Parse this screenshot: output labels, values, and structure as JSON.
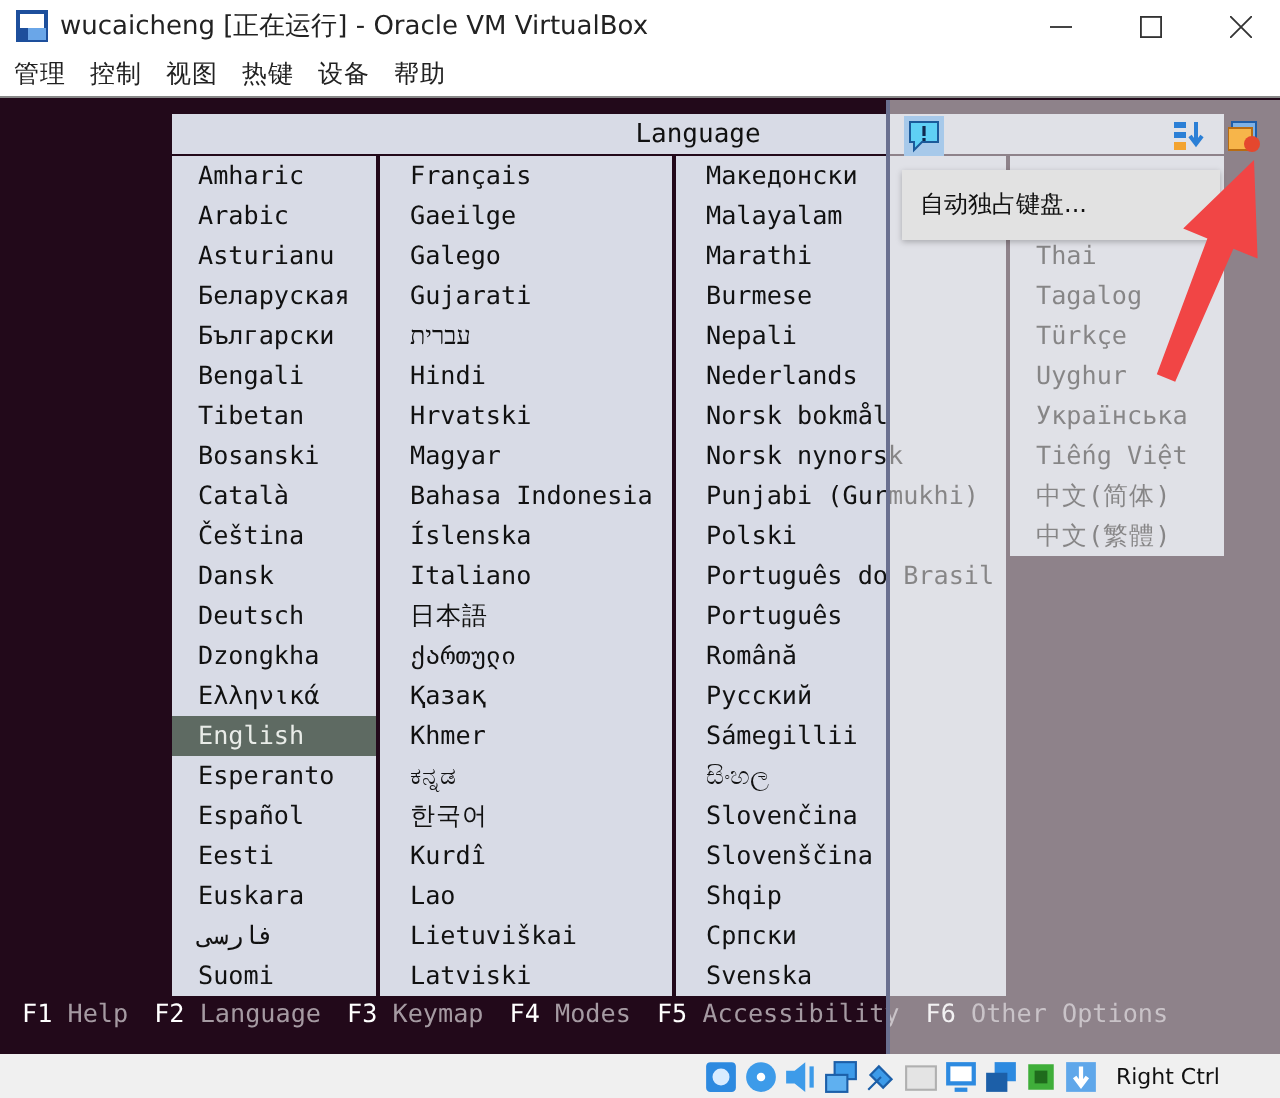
{
  "window": {
    "title": "wucaicheng [正在运行] - Oracle VM VirtualBox"
  },
  "menu": [
    "管理",
    "控制",
    "视图",
    "热键",
    "设备",
    "帮助"
  ],
  "dialog": {
    "title": "Language",
    "columns": [
      {
        "kind": "full",
        "items": [
          {
            "label": "Amharic",
            "selected": false
          },
          {
            "label": "Arabic",
            "selected": false
          },
          {
            "label": "Asturianu",
            "selected": false
          },
          {
            "label": "Беларуская",
            "selected": false
          },
          {
            "label": "Български",
            "selected": false
          },
          {
            "label": "Bengali",
            "selected": false
          },
          {
            "label": "Tibetan",
            "selected": false
          },
          {
            "label": "Bosanski",
            "selected": false
          },
          {
            "label": "Català",
            "selected": false
          },
          {
            "label": "Čeština",
            "selected": false
          },
          {
            "label": "Dansk",
            "selected": false
          },
          {
            "label": "Deutsch",
            "selected": false
          },
          {
            "label": "Dzongkha",
            "selected": false
          },
          {
            "label": "Ελληνικά",
            "selected": false
          },
          {
            "label": "English",
            "selected": true
          },
          {
            "label": "Esperanto",
            "selected": false
          },
          {
            "label": "Español",
            "selected": false
          },
          {
            "label": "Eesti",
            "selected": false
          },
          {
            "label": "Euskara",
            "selected": false
          },
          {
            "label": "فارسی",
            "selected": false
          },
          {
            "label": "Suomi",
            "selected": false
          }
        ]
      },
      {
        "kind": "full",
        "items": [
          {
            "label": "Français",
            "selected": false
          },
          {
            "label": "Gaeilge",
            "selected": false
          },
          {
            "label": "Galego",
            "selected": false
          },
          {
            "label": "Gujarati",
            "selected": false
          },
          {
            "label": "עברית",
            "selected": false
          },
          {
            "label": "Hindi",
            "selected": false
          },
          {
            "label": "Hrvatski",
            "selected": false
          },
          {
            "label": "Magyar",
            "selected": false
          },
          {
            "label": "Bahasa Indonesia",
            "selected": false
          },
          {
            "label": "Íslenska",
            "selected": false
          },
          {
            "label": "Italiano",
            "selected": false
          },
          {
            "label": "日本語",
            "selected": false
          },
          {
            "label": "ქართული",
            "selected": false
          },
          {
            "label": "Қазақ",
            "selected": false
          },
          {
            "label": "Khmer",
            "selected": false
          },
          {
            "label": "ಕನ್ನಡ",
            "selected": false
          },
          {
            "label": "한국어",
            "selected": false
          },
          {
            "label": "Kurdî",
            "selected": false
          },
          {
            "label": "Lao",
            "selected": false
          },
          {
            "label": "Lietuviškai",
            "selected": false
          },
          {
            "label": "Latviski",
            "selected": false
          }
        ]
      },
      {
        "kind": "full",
        "items": [
          {
            "label": "Македонски",
            "selected": false
          },
          {
            "label": "Malayalam",
            "selected": false
          },
          {
            "label": "Marathi",
            "selected": false
          },
          {
            "label": "Burmese",
            "selected": false
          },
          {
            "label": "Nepali",
            "selected": false
          },
          {
            "label": "Nederlands",
            "selected": false
          },
          {
            "label": "Norsk bokmål",
            "selected": false
          },
          {
            "label": "Norsk nynorsk",
            "selected": false
          },
          {
            "label": "Punjabi (Gurmukhi)",
            "selected": false
          },
          {
            "label": "Polski",
            "selected": false
          },
          {
            "label": "Português do Brasil",
            "selected": false
          },
          {
            "label": "Português",
            "selected": false
          },
          {
            "label": "Română",
            "selected": false
          },
          {
            "label": "Русский",
            "selected": false
          },
          {
            "label": "Sámegillii",
            "selected": false
          },
          {
            "label": "සිංහල",
            "selected": false
          },
          {
            "label": "Slovenčina",
            "selected": false
          },
          {
            "label": "Slovenščina",
            "selected": false
          },
          {
            "label": "Shqip",
            "selected": false
          },
          {
            "label": "Српски",
            "selected": false
          },
          {
            "label": "Svenska",
            "selected": false
          }
        ]
      },
      {
        "kind": "partial",
        "items": [
          {
            "label": "Thai",
            "selected": false
          },
          {
            "label": "Tagalog",
            "selected": false
          },
          {
            "label": "Türkçe",
            "selected": false
          },
          {
            "label": "Uyghur",
            "selected": false
          },
          {
            "label": "Українська",
            "selected": false
          },
          {
            "label": "Tiếng Việt",
            "selected": false
          },
          {
            "label": "中文(简体)",
            "selected": false
          },
          {
            "label": "中文(繁體)",
            "selected": false
          }
        ]
      }
    ]
  },
  "function_keys": [
    {
      "key": "F1",
      "label": "Help"
    },
    {
      "key": "F2",
      "label": "Language"
    },
    {
      "key": "F3",
      "label": "Keymap"
    },
    {
      "key": "F4",
      "label": "Modes"
    },
    {
      "key": "F5",
      "label": "Accessibility"
    },
    {
      "key": "F6",
      "label": "Other Options"
    }
  ],
  "overlay": {
    "popup_item": "自动独占键盘..."
  },
  "status_bar": {
    "host_key": "Right Ctrl"
  }
}
